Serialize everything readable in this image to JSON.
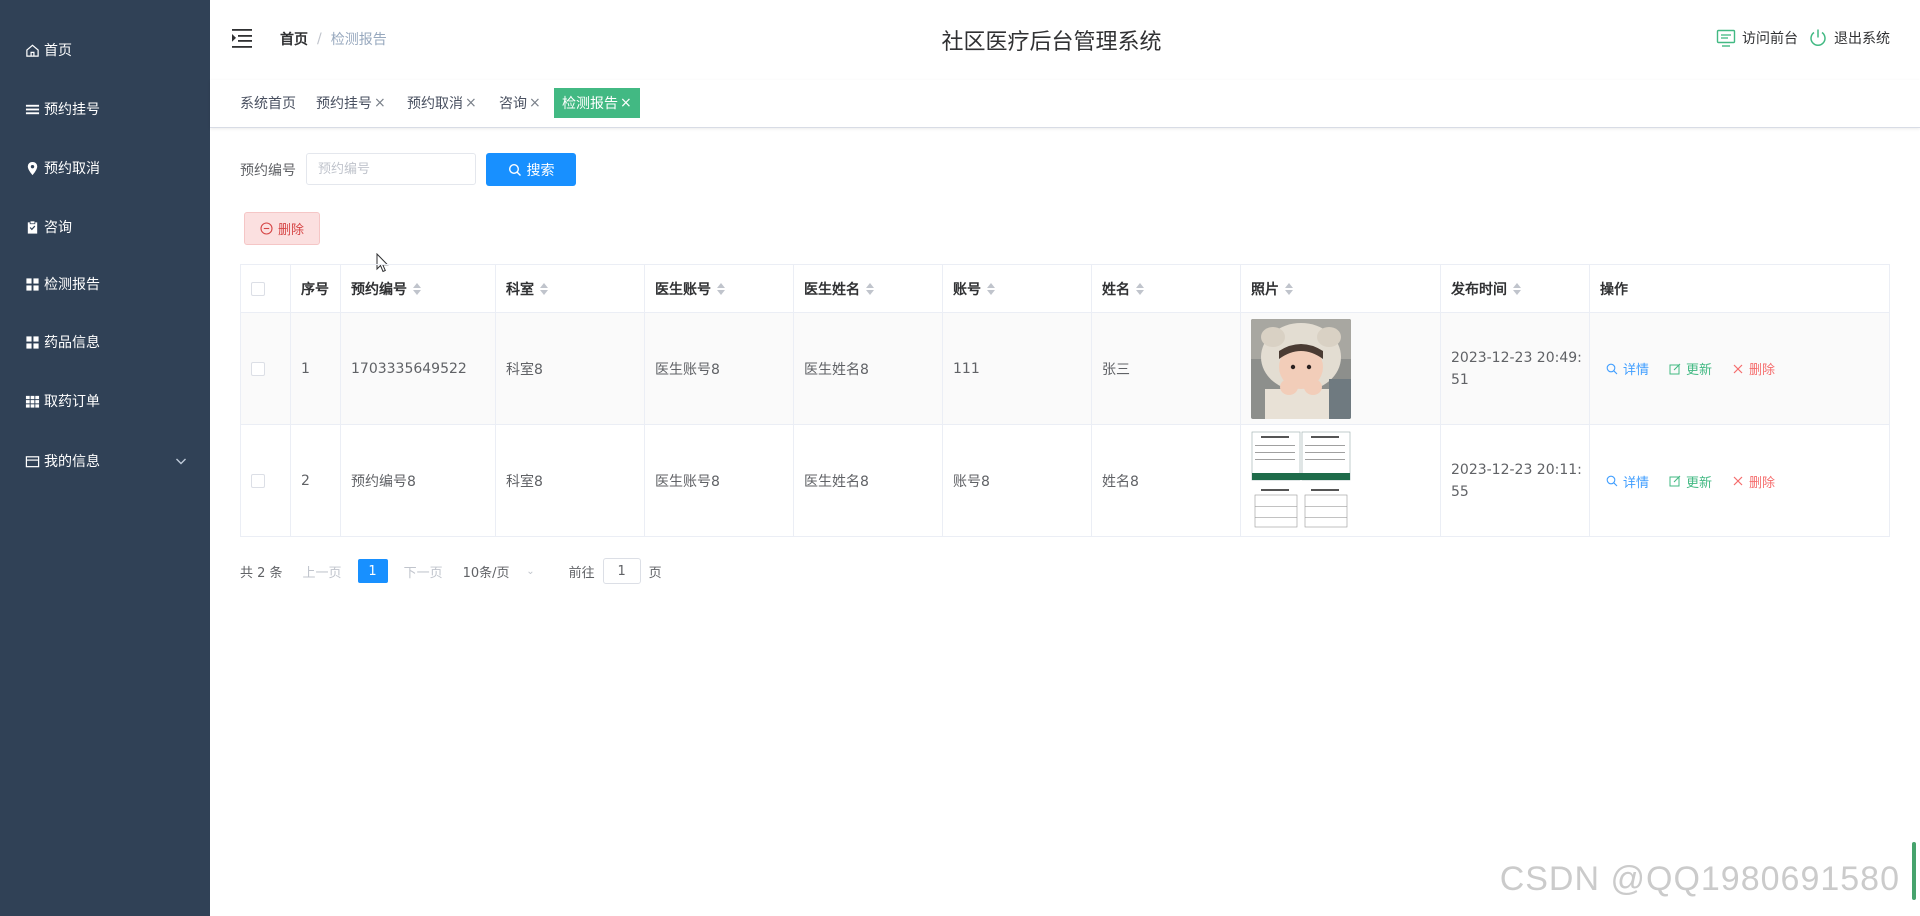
{
  "sidebar": {
    "items": [
      {
        "label": "首页",
        "icon": "home-icon"
      },
      {
        "label": "预约挂号",
        "icon": "list-icon"
      },
      {
        "label": "预约取消",
        "icon": "location-icon"
      },
      {
        "label": "咨询",
        "icon": "clipboard-icon"
      },
      {
        "label": "检测报告",
        "icon": "grid-icon"
      },
      {
        "label": "药品信息",
        "icon": "grid-icon"
      },
      {
        "label": "取药订单",
        "icon": "table-icon"
      },
      {
        "label": "我的信息",
        "icon": "wallet-icon"
      }
    ]
  },
  "header": {
    "breadcrumb_home": "首页",
    "breadcrumb_sep": "/",
    "breadcrumb_current": "检测报告",
    "title": "社区医疗后台管理系统",
    "visit_front": "访问前台",
    "logout": "退出系统"
  },
  "tags": [
    {
      "label": "系统首页",
      "closable": false,
      "active": false
    },
    {
      "label": "预约挂号",
      "closable": true,
      "active": false
    },
    {
      "label": "预约取消",
      "closable": true,
      "active": false
    },
    {
      "label": "咨询",
      "closable": true,
      "active": false
    },
    {
      "label": "检测报告",
      "closable": true,
      "active": true
    }
  ],
  "tag_close_glyph": "×",
  "search": {
    "label": "预约编号",
    "placeholder": "预约编号",
    "button": "搜索"
  },
  "toolbar": {
    "delete_label": "删除"
  },
  "table": {
    "columns": [
      "序号",
      "预约编号",
      "科室",
      "医生账号",
      "医生姓名",
      "账号",
      "姓名",
      "照片",
      "发布时间",
      "操作"
    ],
    "rows": [
      {
        "index": "1",
        "appointment_no": "1703335649522",
        "department": "科室8",
        "doctor_account": "医生账号8",
        "doctor_name": "医生姓名8",
        "account": "111",
        "name": "张三",
        "photo": "child-photo",
        "time_line1": "2023-12-23 20:49:",
        "time_line2": "51"
      },
      {
        "index": "2",
        "appointment_no": "预约编号8",
        "department": "科室8",
        "doctor_account": "医生账号8",
        "doctor_name": "医生姓名8",
        "account": "账号8",
        "name": "姓名8",
        "photo": "document-photo",
        "time_line1": "2023-12-23 20:11:",
        "time_line2": "55"
      }
    ],
    "actions": {
      "detail": "详情",
      "update": "更新",
      "delete": "删除"
    }
  },
  "pagination": {
    "total": "共 2 条",
    "prev": "上一页",
    "current": "1",
    "next": "下一页",
    "page_size": "10条/页",
    "goto_prefix": "前往",
    "goto_value": "1",
    "goto_suffix": "页"
  },
  "watermark": "CSDN @QQ1980691580",
  "colors": {
    "sidebar_bg": "#304156",
    "active_tag": "#42b983",
    "primary": "#1890ff",
    "danger": "#f56c6c",
    "success": "#42b983"
  }
}
